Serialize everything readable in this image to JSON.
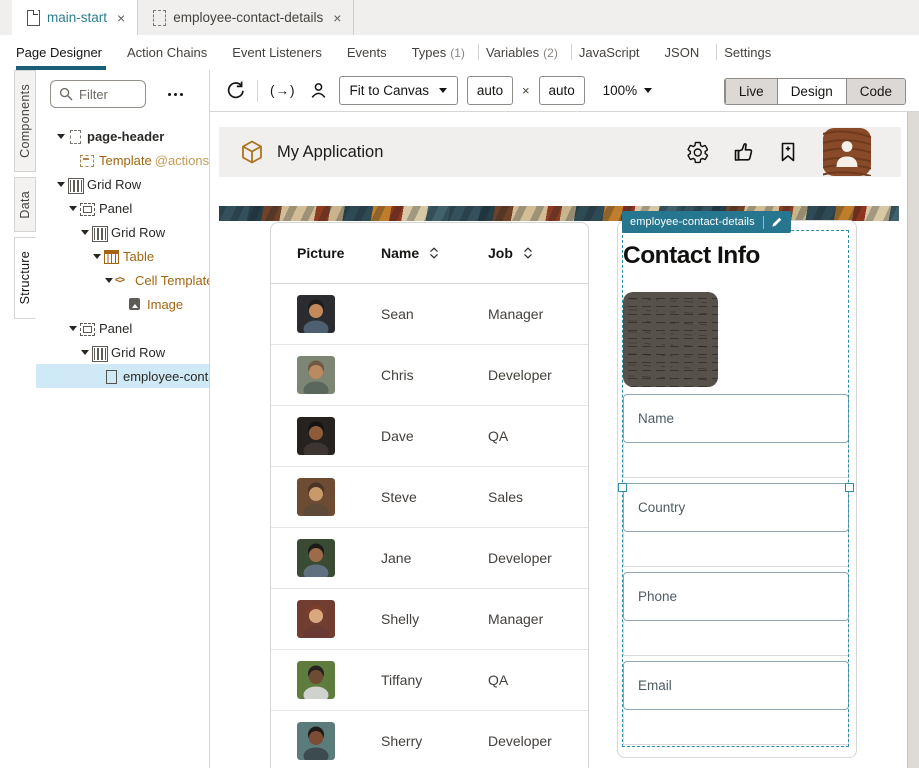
{
  "doc_tabs": [
    {
      "label": "main-start",
      "icon": "page",
      "active": true
    },
    {
      "label": "employee-contact-details",
      "icon": "page-dashed"
    }
  ],
  "nav_tabs": [
    {
      "label": "Page Designer",
      "active": true
    },
    {
      "label": "Action Chains"
    },
    {
      "label": "Event Listeners"
    },
    {
      "label": "Events"
    },
    {
      "label": "Types",
      "count": "(1)",
      "divider_after": true
    },
    {
      "label": "Variables",
      "count": "(2)",
      "divider_after": true
    },
    {
      "label": "JavaScript"
    },
    {
      "label": "JSON",
      "divider_after": true
    },
    {
      "label": "Settings"
    }
  ],
  "side_tabs": [
    {
      "label": "Components"
    },
    {
      "label": "Data"
    },
    {
      "label": "Structure",
      "active": true
    }
  ],
  "structure": {
    "filter_placeholder": "Filter",
    "tree": [
      {
        "label": "page-header",
        "icon": "page-dashed",
        "depth": 0,
        "caret": true,
        "cls": "dark bold"
      },
      {
        "label": "Template",
        "suffix": "@actions",
        "icon": "template",
        "depth": 1,
        "caret": false,
        "cls": "orange"
      },
      {
        "label": "Grid Row",
        "icon": "gridrow",
        "depth": 0,
        "caret": true,
        "cls": "dark"
      },
      {
        "label": "Panel",
        "icon": "panel",
        "depth": 1,
        "caret": true,
        "cls": "dark"
      },
      {
        "label": "Grid Row",
        "icon": "gridrow",
        "depth": 2,
        "caret": true,
        "cls": "dark"
      },
      {
        "label": "Table",
        "icon": "table",
        "depth": 3,
        "caret": true,
        "cls": "orange"
      },
      {
        "label": "Cell Template",
        "icon": "code",
        "depth": 4,
        "caret": true,
        "cls": "orange"
      },
      {
        "label": "Image",
        "icon": "image",
        "depth": 5,
        "caret": false,
        "cls": "orange"
      },
      {
        "label": "Panel",
        "icon": "panel",
        "depth": 1,
        "caret": true,
        "cls": "dark"
      },
      {
        "label": "Grid Row",
        "icon": "gridrow",
        "depth": 2,
        "caret": true,
        "cls": "dark"
      },
      {
        "label": "employee-contact-details",
        "icon": "page",
        "depth": 3,
        "caret": false,
        "cls": "dark",
        "active": true
      }
    ]
  },
  "toolbar": {
    "paren_arrow": "(→)",
    "fit_label": "Fit to Canvas",
    "width_value": "auto",
    "times": "×",
    "height_value": "auto",
    "zoom_value": "100%",
    "modes": [
      {
        "label": "Live"
      },
      {
        "label": "Design",
        "active": true
      },
      {
        "label": "Code"
      }
    ]
  },
  "canvas": {
    "app_title": "My Application",
    "selection_badge": "employee-contact-details",
    "table": {
      "columns": [
        {
          "label": "Picture",
          "cls": "c1"
        },
        {
          "label": "Name",
          "sortable": true,
          "cls": "c2"
        },
        {
          "label": "Job",
          "sortable": true,
          "cls": "c3"
        }
      ],
      "rows": [
        {
          "name": "Sean",
          "job": "Manager",
          "avatar": {
            "bg": "#2b2c30",
            "skin": "#c28a5a",
            "hair": "#1e1d1b",
            "shirt": "#4e6070"
          }
        },
        {
          "name": "Chris",
          "job": "Developer",
          "avatar": {
            "bg": "#7d8672",
            "skin": "#bb8a60",
            "hair": "#6e5a44",
            "shirt": "#5a675c"
          }
        },
        {
          "name": "Dave",
          "job": "QA",
          "avatar": {
            "bg": "#262220",
            "skin": "#8f5c39",
            "hair": "#151311",
            "shirt": "#3c3531"
          }
        },
        {
          "name": "Steve",
          "job": "Sales",
          "avatar": {
            "bg": "#6e4c34",
            "skin": "#c79a6a",
            "hair": "#4a3423",
            "shirt": "#5d4a38"
          }
        },
        {
          "name": "Jane",
          "job": "Developer",
          "avatar": {
            "bg": "#3a4a33",
            "skin": "#9c6c48",
            "hair": "#1c1a18",
            "shirt": "#607080"
          }
        },
        {
          "name": "Shelly",
          "job": "Manager",
          "avatar": {
            "bg": "#713d30",
            "skin": "#d9a87c",
            "hair": "#7c3e2a",
            "shirt": "#6a3a34"
          }
        },
        {
          "name": "Tiffany",
          "job": "QA",
          "avatar": {
            "bg": "#5f7c3f",
            "skin": "#6e4c33",
            "hair": "#26211d",
            "shirt": "#cfd2cd"
          }
        },
        {
          "name": "Sherry",
          "job": "Developer",
          "avatar": {
            "bg": "#5c7b7b",
            "skin": "#7c4c35",
            "hair": "#1f1b19",
            "shirt": "#3d4a4e"
          }
        }
      ]
    },
    "contact_panel": {
      "title": "Contact Info",
      "fields": [
        "Name",
        "Country",
        "Phone",
        "Email"
      ]
    }
  }
}
